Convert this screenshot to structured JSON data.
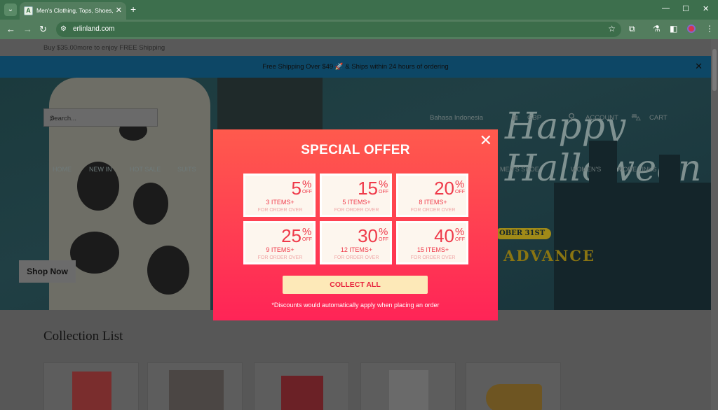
{
  "browser": {
    "tab_title": "Men's Clothing, Tops, Shoes, A",
    "url": "erlinland.com",
    "favicon_letter": "A"
  },
  "page": {
    "ship_bar": "Buy $35.00more to enjoy FREE Shipping",
    "notice": "Free Shipping Over $49 🚀 & Ships within 24 hours of ordering",
    "search_placeholder": "Search...",
    "language": "Bahasa Indonesia",
    "currency": "GBP",
    "account": "ACCOUNT",
    "cart": "CART",
    "nav": [
      "HOME",
      "NEW IN",
      "HOT SALE",
      "SUITS",
      "MEN'S SHOE",
      "WOMEN'S",
      "MORE LINKS"
    ],
    "shop_now": "Shop Now",
    "hero_script": "Happy Halloween",
    "oct_badge": "OBER 31ST",
    "advance": "ADVANCE",
    "collection_title": "Collection List"
  },
  "modal": {
    "title": "SPECIAL OFFER",
    "coupons": [
      {
        "value": "5",
        "items": "3 ITEMS+"
      },
      {
        "value": "15",
        "items": "5 ITEMS+"
      },
      {
        "value": "20",
        "items": "8 ITEMS+"
      },
      {
        "value": "25",
        "items": "9 ITEMS+"
      },
      {
        "value": "30",
        "items": "12 ITEMS+"
      },
      {
        "value": "40",
        "items": "15 ITEMS+"
      }
    ],
    "pct": "%",
    "off": "OFF",
    "for_order": "FOR ORDER OVER",
    "collect_label": "COLLECT ALL",
    "note": "*Discounts would automatically apply when placing an order"
  },
  "colors": {
    "accent": "#ff3d52",
    "coupon_text": "#ef3a4a",
    "collect_bg": "#fde9b8"
  }
}
